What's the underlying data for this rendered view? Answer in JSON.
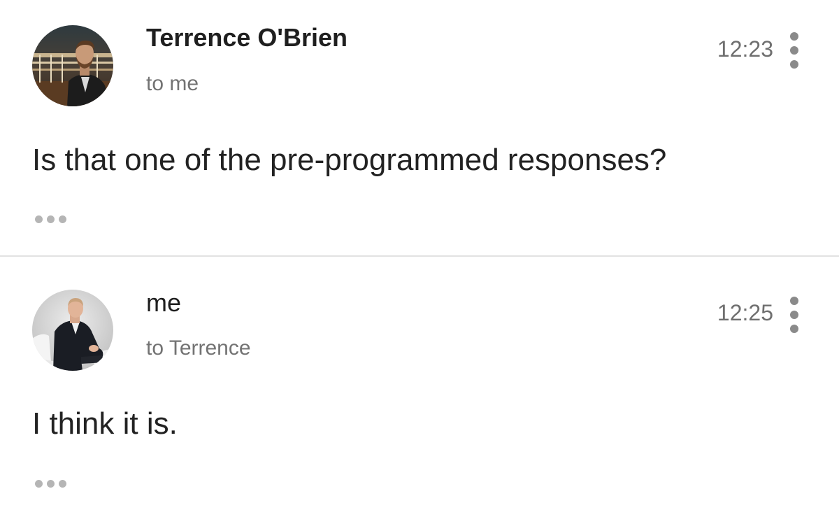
{
  "messages": [
    {
      "sender": "Terrence O'Brien",
      "recipient": "to me",
      "time": "12:23",
      "body": "Is that one of the pre-programmed responses?",
      "avatar_icon": "avatar-photo-terrence",
      "more_icon": "more-vert-icon",
      "expand_icon": "ellipsis-expand-icon"
    },
    {
      "sender": "me",
      "recipient": "to Terrence",
      "time": "12:25",
      "body": "I think it is.",
      "avatar_icon": "avatar-photo-me",
      "more_icon": "more-vert-icon",
      "expand_icon": "ellipsis-expand-icon"
    }
  ],
  "colors": {
    "text_primary": "#1f1f1f",
    "text_secondary": "#737373",
    "icon_gray": "#8a8a8a",
    "divider": "#e2e2e2",
    "background": "#ffffff"
  }
}
